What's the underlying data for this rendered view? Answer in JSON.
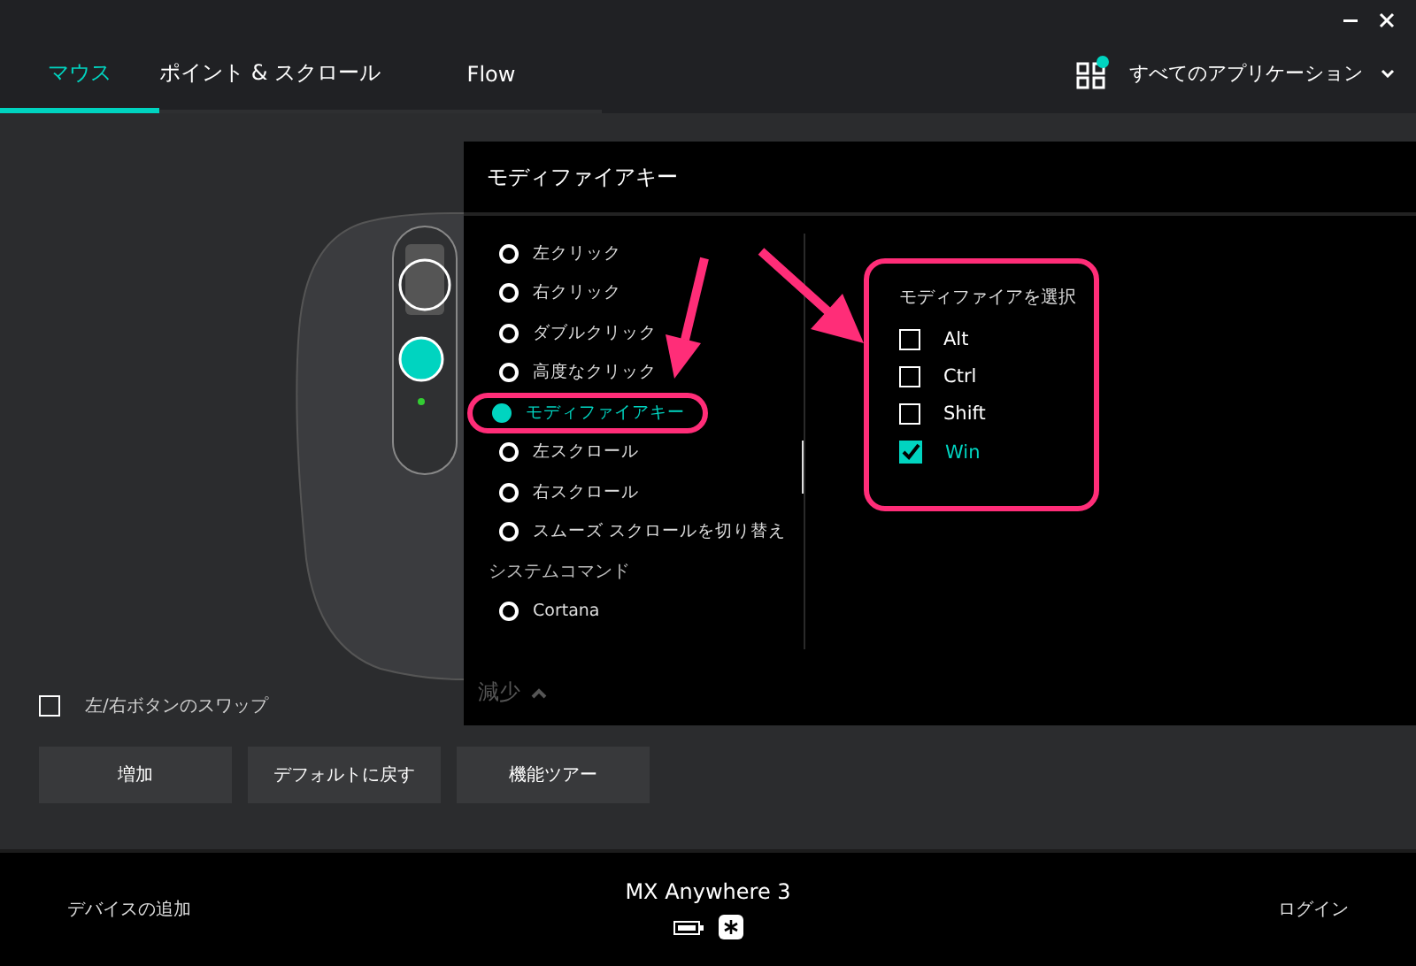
{
  "tabs": [
    {
      "label": "マウス",
      "selected": true
    },
    {
      "label": "ポイント & スクロール",
      "selected": false
    },
    {
      "label": "Flow",
      "selected": false
    }
  ],
  "app_selector": {
    "label": "すべてのアプリケーション",
    "notification": true
  },
  "modifier_panel": {
    "title": "モディファイアキー",
    "actions": [
      {
        "label": "左クリック",
        "selected": false
      },
      {
        "label": "右クリック",
        "selected": false
      },
      {
        "label": "ダブルクリック",
        "selected": false
      },
      {
        "label": "高度なクリック",
        "selected": false
      },
      {
        "label": "モディファイアキー",
        "selected": true
      },
      {
        "label": "左スクロール",
        "selected": false
      },
      {
        "label": "右スクロール",
        "selected": false
      },
      {
        "label": "スムーズ スクロールを切り替え",
        "selected": false
      }
    ],
    "section": "システムコマンド",
    "system_actions": [
      {
        "label": "Cortana",
        "selected": false
      }
    ],
    "collapse": "減少",
    "modifier_group": {
      "title": "モディファイアを選択",
      "options": [
        {
          "label": "Alt",
          "checked": false
        },
        {
          "label": "Ctrl",
          "checked": false
        },
        {
          "label": "Shift",
          "checked": false
        },
        {
          "label": "Win",
          "checked": true
        }
      ]
    }
  },
  "swap": {
    "label": "左/右ボタンのスワップ",
    "checked": false
  },
  "buttons": [
    "増加",
    "デフォルトに戻す",
    "機能ツアー"
  ],
  "footer": {
    "add_device": "デバイスの追加",
    "device_name": "MX Anywhere 3",
    "login": "ログイン"
  }
}
